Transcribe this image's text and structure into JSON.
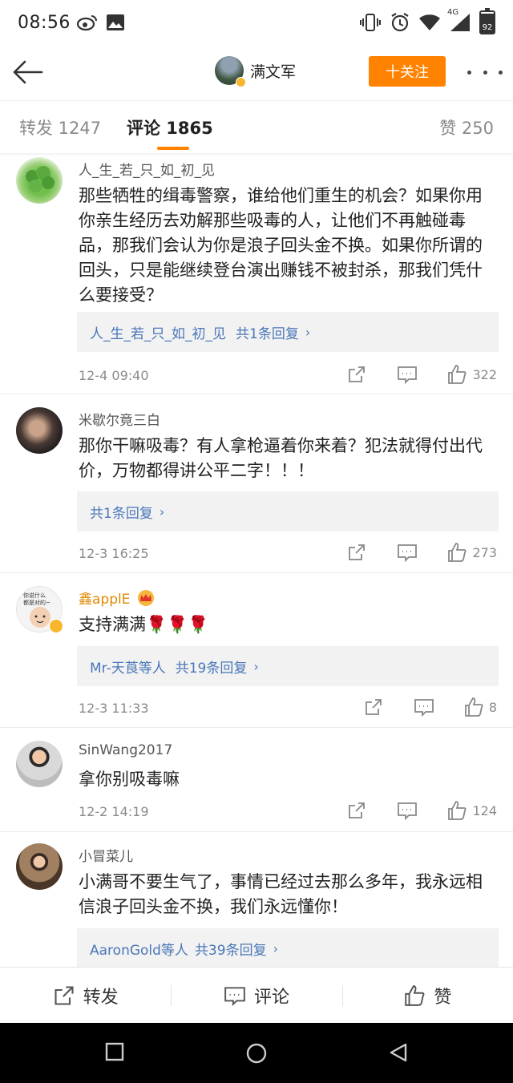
{
  "status_bar": {
    "time": "08:56",
    "network": "4G",
    "battery": "92"
  },
  "nav": {
    "user_name": "满文军",
    "follow_label": "十关注"
  },
  "tabs": {
    "forward": "转发 1247",
    "comments": "评论 1865",
    "likes": "赞 250"
  },
  "comments": [
    {
      "name": "人_生_若_只_如_初_见",
      "text": "那些牺牲的缉毒警察，谁给他们重生的机会？如果你用你亲生经历去劝解那些吸毒的人，让他们不再触碰毒品，那我们会认为你是浪子回头金不换。如果你所谓的回头，只是能继续登台演出赚钱不被封杀，那我们凭什么要接受？",
      "reply_prefix": "人_生_若_只_如_初_见",
      "reply_count": "共1条回复",
      "time": "12-4 09:40",
      "likes": "322"
    },
    {
      "name": "米歇尔竟三白",
      "text": "那你干嘛吸毒？有人拿枪逼着你来着？犯法就得付出代价，万物都得讲公平二字！！！",
      "reply_prefix": "",
      "reply_count": "共1条回复",
      "time": "12-3 16:25",
      "likes": "273"
    },
    {
      "name": "鑫applE",
      "text": "支持满满🌹🌹🌹",
      "reply_prefix": "Mr-天莨等人",
      "reply_count": "共19条回复",
      "time": "12-3 11:33",
      "likes": "8",
      "avatar_caption_1": "你说什么",
      "avatar_caption_2": "都是对的~"
    },
    {
      "name": "SinWang2017",
      "text": "拿你别吸毒嘛",
      "time": "12-2 14:19",
      "likes": "124"
    },
    {
      "name": "小冒菜儿",
      "text": "小满哥不要生气了，事情已经过去那么多年，我永远相信浪子回头金不换，我们永远懂你！",
      "reply_prefix": "AaronGold等人",
      "reply_count": "共39条回复"
    }
  ],
  "bottom_bar": {
    "forward": "转发",
    "comment": "评论",
    "like": "赞"
  },
  "colors": {
    "accent": "#ff8200",
    "link": "#4a77b8",
    "name_gold": "#e08a00",
    "muted": "#8a8a8a"
  }
}
